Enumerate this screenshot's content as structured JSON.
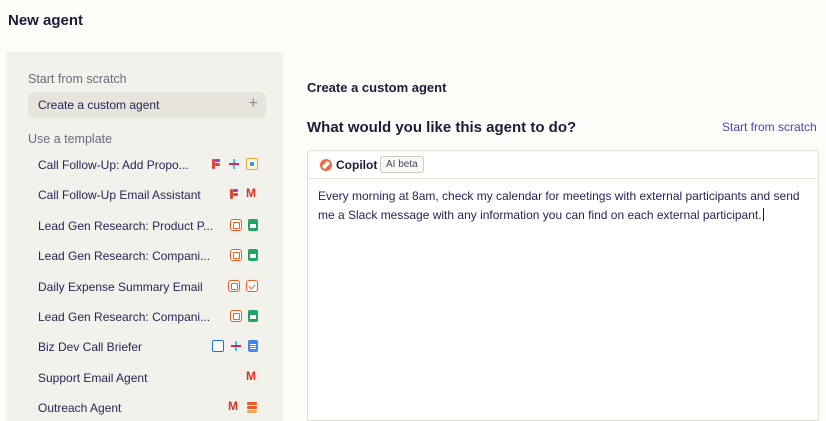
{
  "header": {
    "title": "New agent"
  },
  "sidebar": {
    "scratch_section": "Start from scratch",
    "scratch_item": {
      "label": "Create a custom agent",
      "icon": "plus-icon"
    },
    "template_section": "Use a template",
    "templates": [
      {
        "label": "Call Follow-Up: Add Propo...",
        "icons": [
          "forms",
          "slack",
          "timer"
        ]
      },
      {
        "label": "Call Follow-Up Email Assistant",
        "icons": [
          "forms",
          "gmail"
        ]
      },
      {
        "label": "Lead Gen Research: Product P...",
        "icons": [
          "zapier",
          "sheets"
        ]
      },
      {
        "label": "Lead Gen Research: Compani...",
        "icons": [
          "zapier",
          "sheets"
        ]
      },
      {
        "label": "Daily Expense Summary Email",
        "icons": [
          "zapier",
          "email"
        ]
      },
      {
        "label": "Lead Gen Research: Compani...",
        "icons": [
          "zapier",
          "sheets"
        ]
      },
      {
        "label": "Biz Dev Call Briefer",
        "icons": [
          "outlook",
          "slack",
          "docs"
        ]
      },
      {
        "label": "Support Email Agent",
        "icons": [
          "gmail"
        ]
      },
      {
        "label": "Outreach Agent",
        "icons": [
          "gmail",
          "parts"
        ]
      }
    ]
  },
  "main": {
    "subtitle": "Create a custom agent",
    "question": "What would you like this agent to do?",
    "scratch_link": "Start from scratch",
    "copilot": {
      "label": "Copilot",
      "badge": "AI beta",
      "prompt": "Every morning at 8am, check my calendar for meetings with external participants and send me a Slack message with any information you can find on each external participant."
    }
  }
}
